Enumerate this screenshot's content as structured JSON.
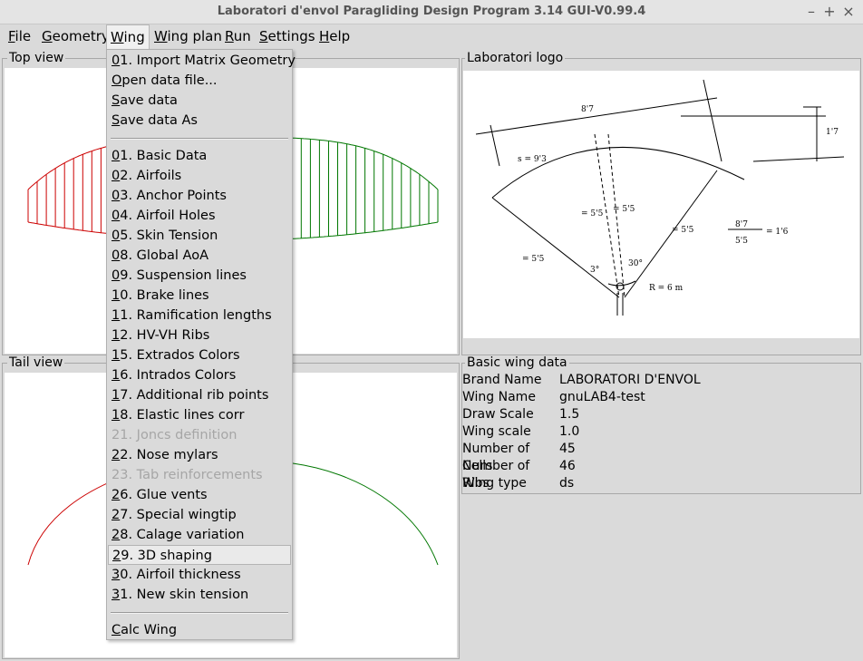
{
  "window": {
    "title": "Laboratori d'envol Paragliding Design Program 3.14 GUI-V0.99.4"
  },
  "menubar": {
    "items": [
      {
        "pre": "",
        "u": "F",
        "post": "ile"
      },
      {
        "pre": "",
        "u": "G",
        "post": "eometry"
      },
      {
        "pre": "",
        "u": "W",
        "post": "ing"
      },
      {
        "pre": "",
        "u": "W",
        "post": "ing plan"
      },
      {
        "pre": "",
        "u": "R",
        "post": "un"
      },
      {
        "pre": "",
        "u": "S",
        "post": "ettings"
      },
      {
        "pre": "",
        "u": "H",
        "post": "elp"
      }
    ]
  },
  "panels": {
    "top_view": "Top view",
    "tail_view": "Tail view",
    "logo": "Laboratori logo",
    "basic": "Basic wing data"
  },
  "wing_menu": {
    "items": [
      {
        "u": "0",
        "post": "1. Import Matrix Geometry"
      },
      {
        "u": "O",
        "post": "pen data file..."
      },
      {
        "u": "S",
        "post": "ave data"
      },
      {
        "u": "S",
        "post": "ave data As"
      },
      {
        "u": "0",
        "post": "1. Basic Data"
      },
      {
        "u": "0",
        "post": "2. Airfoils"
      },
      {
        "u": "0",
        "post": "3. Anchor Points"
      },
      {
        "u": "0",
        "post": "4. Airfoil Holes"
      },
      {
        "u": "0",
        "post": "5. Skin Tension"
      },
      {
        "u": "0",
        "post": "8. Global AoA"
      },
      {
        "u": "0",
        "post": "9. Suspension lines"
      },
      {
        "u": "1",
        "post": "0. Brake lines"
      },
      {
        "u": "1",
        "post": "1. Ramification lengths"
      },
      {
        "u": "1",
        "post": "2. HV-VH Ribs"
      },
      {
        "u": "1",
        "post": "5. Extrados Colors"
      },
      {
        "u": "1",
        "post": "6. Intrados Colors"
      },
      {
        "u": "1",
        "post": "7. Additional rib points"
      },
      {
        "u": "1",
        "post": "8. Elastic lines corr"
      },
      {
        "u": "",
        "post": "21. Joncs definition",
        "disabled": true
      },
      {
        "u": "2",
        "post": "2. Nose mylars"
      },
      {
        "u": "",
        "post": "23. Tab reinforcements",
        "disabled": true
      },
      {
        "u": "2",
        "post": "6. Glue vents"
      },
      {
        "u": "2",
        "post": "7. Special wingtip"
      },
      {
        "u": "2",
        "post": "8. Calage variation"
      },
      {
        "u": "2",
        "post": "9. 3D shaping",
        "highlighted": true
      },
      {
        "u": "3",
        "post": "0. Airfoil thickness"
      },
      {
        "u": "3",
        "post": "1. New skin tension"
      },
      {
        "u": "C",
        "post": "alc Wing"
      }
    ]
  },
  "basic_data": [
    {
      "k": "Brand Name",
      "v": "LABORATORI D'ENVOL"
    },
    {
      "k": "Wing Name",
      "v": "gnuLAB4-test"
    },
    {
      "k": "Draw Scale",
      "v": "1.5"
    },
    {
      "k": "Wing scale",
      "v": "1.0"
    },
    {
      "k": "Number of Cells",
      "v": "45"
    },
    {
      "k": "Number of Ribs",
      "v": "46"
    },
    {
      "k": "Wing type",
      "v": "ds"
    }
  ],
  "colors": {
    "left_half": "#cc0000",
    "right_half": "#007700",
    "highlight": "#eaeaea"
  },
  "logo_text": {
    "span_top": "8'7",
    "height_right": "1'7",
    "arc_len": "s = 9'3",
    "c1": "= 5'5",
    "c2": "= 5'5",
    "line_left": "= 5'5",
    "line_right": "= 5'5",
    "ang1": "3°",
    "ang2": "30°",
    "radius": "R = 6 m",
    "ratio_top": "8'7",
    "ratio_bot": "5'5",
    "ratio_res": "= 1'6"
  }
}
